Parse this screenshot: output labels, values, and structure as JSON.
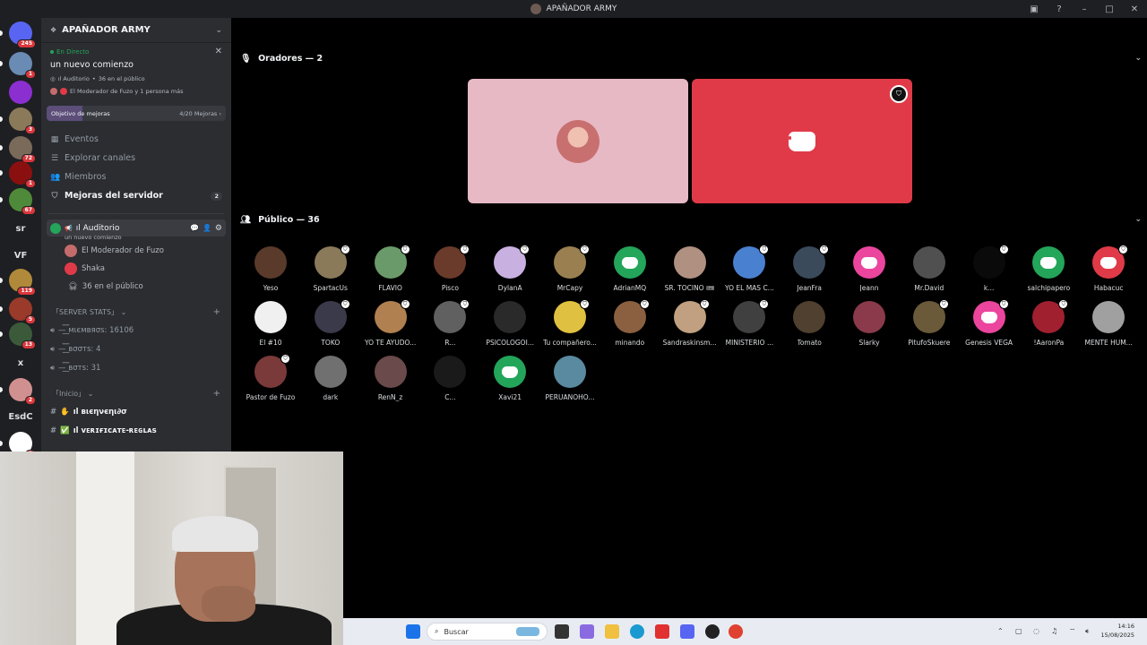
{
  "window": {
    "title": "APAÑADOR ARMY"
  },
  "guilds": [
    {
      "badge": "245",
      "color": "#5865f2",
      "text": ""
    },
    {
      "badge": "1",
      "color": "#6a8bb3",
      "text": ""
    },
    {
      "badge": "",
      "color": "#8c2fd0",
      "text": ""
    },
    {
      "badge": "3",
      "color": "#8a7a5a",
      "text": ""
    },
    {
      "badge": "72",
      "color": "#7a6a5a",
      "text": ""
    },
    {
      "badge": "1",
      "color": "#8a1010",
      "text": ""
    },
    {
      "badge": "67",
      "color": "#4f8a3a",
      "text": ""
    },
    {
      "badge": "",
      "color": "",
      "text": "sr"
    },
    {
      "badge": "",
      "color": "",
      "text": "VF"
    },
    {
      "badge": "119",
      "color": "#b08a3a",
      "text": ""
    },
    {
      "badge": "5",
      "color": "#9a3a2a",
      "text": ""
    },
    {
      "badge": "13",
      "color": "#3a5a3a",
      "text": ""
    },
    {
      "badge": "",
      "color": "",
      "text": "x"
    },
    {
      "badge": "2",
      "color": "#d09090",
      "text": ""
    },
    {
      "badge": "",
      "color": "",
      "text": "EsdC"
    },
    {
      "badge": "1",
      "color": "#ffffff",
      "text": ""
    }
  ],
  "server": {
    "name": "APAÑADOR ARMY",
    "live_label": "En Directo",
    "live_topic": "un nuevo comienzo",
    "live_channel": "ıl Auditorio",
    "live_audience": "36 en el público",
    "live_speakers": "El Moderador de Fuzo y 1 persona más",
    "boost_label": "Objetivo de mejoras",
    "boost_progress": "4/20 Mejoras",
    "boost_fraction": 0.2,
    "nav": [
      {
        "label": "Eventos",
        "icon": "calendar-icon",
        "glyph": "▦"
      },
      {
        "label": "Explorar canales",
        "icon": "browse-icon",
        "glyph": "☰"
      },
      {
        "label": "Miembros",
        "icon": "members-icon",
        "glyph": "👥"
      }
    ],
    "boosts_nav": {
      "label": "Mejoras del servidor",
      "count": "2"
    },
    "stage": {
      "name": "ıl Auditorio",
      "topic": "un nuevo comienzo"
    },
    "stage_users": [
      {
        "name": "El Moderador de Fuzo",
        "color": "#c46b6b"
      },
      {
        "name": "Shaka",
        "color": "#e03a48"
      }
    ],
    "stage_audience": "36 en el público",
    "category_stats": "SERVER STATS",
    "stats": [
      "—͟͞͞ мιємвяσѕ: 16106",
      "—͟͞͞ вσσтѕ: 4",
      "—͟͞͞ вσтѕ: 31"
    ],
    "category_inicio": "Inicio",
    "text_channels": [
      {
        "emoji": "✋",
        "name": "ıl вιєηνєηι∂σ"
      },
      {
        "emoji": "✅",
        "name": "ıl ᴠᴇʀɪғɪᴄᴀᴛᴇ-ʀᴇɢʟᴀs"
      }
    ]
  },
  "stage_view": {
    "speakers_header": "Oradores — 2",
    "audience_header": "Público — 36",
    "speakers": [
      {
        "tile_color": "#e7b9c5",
        "avatar_color": "#c87070",
        "logo": false,
        "moderator": false
      },
      {
        "tile_color": "#e03a48",
        "avatar_color": "",
        "logo": true,
        "moderator": true
      }
    ],
    "audience": [
      {
        "name": "Yeso",
        "color": "#5a3a2a",
        "logo": false,
        "mod": false
      },
      {
        "name": "SpartacUs",
        "color": "#8a7a5a",
        "logo": false,
        "mod": true
      },
      {
        "name": "FLAVIO",
        "color": "#6a9a6a",
        "logo": false,
        "mod": true
      },
      {
        "name": "Pisco",
        "color": "#6a3a2a",
        "logo": false,
        "mod": true
      },
      {
        "name": "DylanA",
        "color": "#c8b0e0",
        "logo": false,
        "mod": true
      },
      {
        "name": "MrCapy",
        "color": "#9a8050",
        "logo": false,
        "mod": true
      },
      {
        "name": "AdrianMQ",
        "color": "#23a55a",
        "logo": true,
        "mod": false
      },
      {
        "name": "SR. TOCINO 🎟",
        "color": "#b09080",
        "logo": false,
        "mod": false
      },
      {
        "name": "YO EL MAS C...",
        "color": "#4a80d0",
        "logo": false,
        "mod": true
      },
      {
        "name": "JeanFra",
        "color": "#3a4a5a",
        "logo": false,
        "mod": true
      },
      {
        "name": "Jeann",
        "color": "#eb459e",
        "logo": true,
        "mod": false
      },
      {
        "name": "Mr.David",
        "color": "#505050",
        "logo": false,
        "mod": false
      },
      {
        "name": "k...",
        "color": "#0a0a0a",
        "logo": false,
        "mod": true
      },
      {
        "name": "salchipapero",
        "color": "#23a55a",
        "logo": true,
        "mod": false
      },
      {
        "name": "Habacuc",
        "color": "#e03a48",
        "logo": true,
        "mod": true
      },
      {
        "name": "El #10",
        "color": "#f0f0f0",
        "logo": false,
        "mod": false
      },
      {
        "name": "TOKO",
        "color": "#3a3a4a",
        "logo": false,
        "mod": true
      },
      {
        "name": "YO TE AYUDO...",
        "color": "#b08050",
        "logo": false,
        "mod": true
      },
      {
        "name": "R...",
        "color": "#606060",
        "logo": false,
        "mod": true
      },
      {
        "name": "PSICOLOGOI...",
        "color": "#2a2a2a",
        "logo": false,
        "mod": false
      },
      {
        "name": "Tu compañero...",
        "color": "#e0c040",
        "logo": false,
        "mod": true
      },
      {
        "name": "minando",
        "color": "#8a6040",
        "logo": false,
        "mod": true
      },
      {
        "name": "Sandraskinsm...",
        "color": "#c0a080",
        "logo": false,
        "mod": true
      },
      {
        "name": "MINISTERIO ...",
        "color": "#404040",
        "logo": false,
        "mod": true
      },
      {
        "name": "Tomato",
        "color": "#504030",
        "logo": false,
        "mod": false
      },
      {
        "name": "Slarky",
        "color": "#8a3a4a",
        "logo": false,
        "mod": false
      },
      {
        "name": "PitufoSkuere",
        "color": "#6a5a3a",
        "logo": false,
        "mod": true
      },
      {
        "name": "Genesis VEGA",
        "color": "#eb459e",
        "logo": true,
        "mod": true
      },
      {
        "name": "!AaronPa",
        "color": "#a02030",
        "logo": false,
        "mod": true
      },
      {
        "name": "MENTE HUM...",
        "color": "#a0a0a0",
        "logo": false,
        "mod": false
      },
      {
        "name": "Pastor de Fuzo",
        "color": "#7a3a3a",
        "logo": false,
        "mod": true
      },
      {
        "name": "dark",
        "color": "#707070",
        "logo": false,
        "mod": false
      },
      {
        "name": "RenN_z",
        "color": "#6a4a4a",
        "logo": false,
        "mod": false
      },
      {
        "name": "C...",
        "color": "#1a1a1a",
        "logo": false,
        "mod": false
      },
      {
        "name": "Xavi21",
        "color": "#23a55a",
        "logo": true,
        "mod": false
      },
      {
        "name": "PERUANOHO...",
        "color": "#5a8aa0",
        "logo": false,
        "mod": false
      }
    ]
  },
  "taskbar": {
    "search_placeholder": "Buscar",
    "time": "14:16",
    "date": "15/08/2025"
  },
  "colors": {
    "accent": "#5865f2",
    "live": "#23a55a",
    "danger": "#da373c"
  }
}
